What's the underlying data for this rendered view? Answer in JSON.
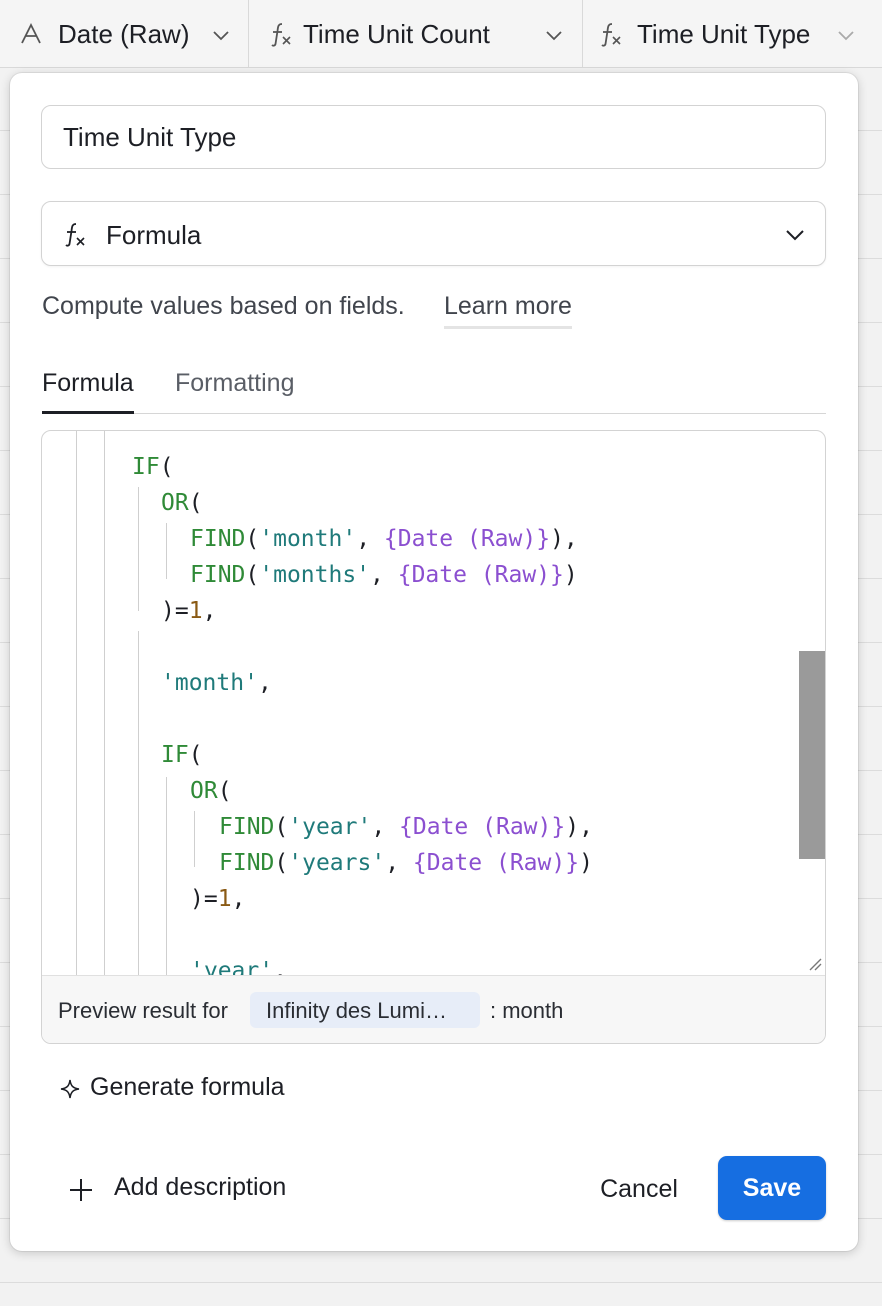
{
  "columns": [
    {
      "icon": "single-line-text-icon",
      "label": "Date (Raw)"
    },
    {
      "icon": "formula-icon",
      "label": "Time Unit Count"
    },
    {
      "icon": "formula-icon",
      "label": "Time Unit Type"
    }
  ],
  "dialog": {
    "field_name": "Time Unit Type",
    "field_type": "Formula",
    "description": "Compute values based on fields.",
    "learn_more": "Learn more",
    "tabs": [
      "Formula",
      "Formatting"
    ],
    "active_tab": "Formula",
    "preview_label": "Preview result for",
    "preview_record": "Infinity des Lumi…",
    "preview_result": ": month",
    "generate_label": "Generate formula",
    "add_description_label": "Add description",
    "cancel_label": "Cancel",
    "save_label": "Save"
  },
  "formula_lines": [
    "IF(",
    "OR(",
    "FIND('month', {Date (Raw)}),",
    "FIND('months', {Date (Raw)})",
    ")=1,",
    "",
    "'month',",
    "",
    "IF(",
    "OR(",
    "FIND('year', {Date (Raw)}),",
    "FIND('years', {Date (Raw)})",
    ")=1,",
    "",
    "'year',"
  ],
  "colors": {
    "keyword": "#2f8a37",
    "string": "#1f7a7a",
    "field": "#8b4fd0",
    "number": "#8a5a14",
    "save_button": "#166ee1"
  }
}
